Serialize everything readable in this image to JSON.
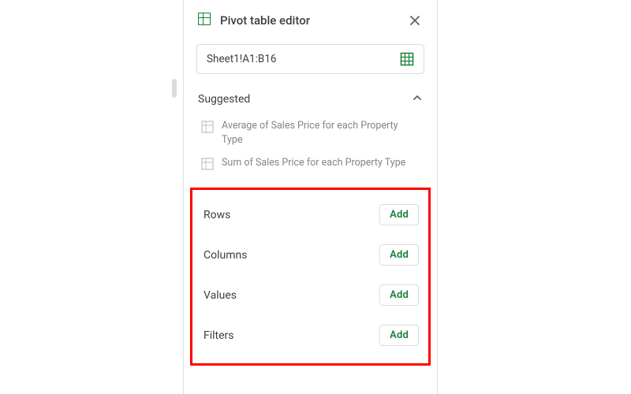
{
  "header": {
    "title": "Pivot table editor"
  },
  "range": {
    "value": "Sheet1!A1:B16"
  },
  "suggested": {
    "label": "Suggested",
    "items": [
      {
        "text": "Average of Sales Price for each Property Type"
      },
      {
        "text": "Sum of Sales Price for each Property Type"
      }
    ]
  },
  "sections": {
    "rows_label": "Rows",
    "columns_label": "Columns",
    "values_label": "Values",
    "filters_label": "Filters",
    "add_label": "Add"
  }
}
